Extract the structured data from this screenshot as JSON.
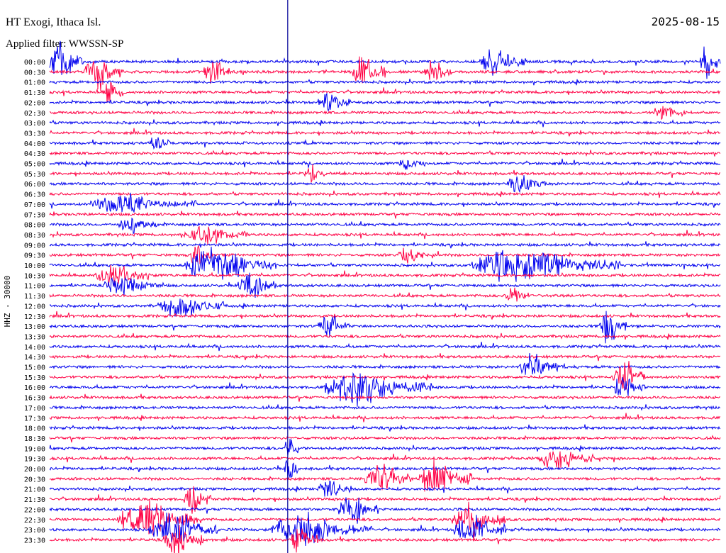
{
  "chart_data": {
    "type": "line",
    "title": "HT Exogi, Ithaca Isl.",
    "date": "2025-08-15",
    "filter": "Applied filter: WWSSN-SP",
    "ylabel": "HHZ - 30000",
    "colors": [
      "#0000ee",
      "#ff0044"
    ],
    "marker_color": "#000099",
    "row_labels": [
      "00:00",
      "00:30",
      "01:00",
      "01:30",
      "02:00",
      "02:30",
      "03:00",
      "03:30",
      "04:00",
      "04:30",
      "05:00",
      "05:30",
      "06:00",
      "06:30",
      "07:00",
      "07:30",
      "08:00",
      "08:30",
      "09:00",
      "09:30",
      "10:00",
      "10:30",
      "11:00",
      "11:30",
      "12:00",
      "12:30",
      "13:00",
      "13:30",
      "14:00",
      "14:30",
      "15:00",
      "15:30",
      "16:00",
      "16:30",
      "17:00",
      "17:30",
      "18:00",
      "18:30",
      "19:00",
      "19:30",
      "20:00",
      "20:30",
      "21:00",
      "21:30",
      "22:00",
      "22:30",
      "23:00",
      "23:30"
    ],
    "bursts": [
      {
        "row": 0,
        "x": 0.0,
        "w": 0.05,
        "amp": 2.2
      },
      {
        "row": 1,
        "x": 0.05,
        "w": 0.06,
        "amp": 1.8
      },
      {
        "row": 1,
        "x": 0.23,
        "w": 0.04,
        "amp": 1.6
      },
      {
        "row": 1,
        "x": 0.45,
        "w": 0.05,
        "amp": 1.8
      },
      {
        "row": 1,
        "x": 0.56,
        "w": 0.04,
        "amp": 1.2
      },
      {
        "row": 0,
        "x": 0.64,
        "w": 0.07,
        "amp": 1.4
      },
      {
        "row": 0,
        "x": 0.97,
        "w": 0.03,
        "amp": 2.2
      },
      {
        "row": 3,
        "x": 0.08,
        "w": 0.03,
        "amp": 1.2
      },
      {
        "row": 4,
        "x": 0.4,
        "w": 0.05,
        "amp": 0.9
      },
      {
        "row": 5,
        "x": 0.9,
        "w": 0.05,
        "amp": 0.9
      },
      {
        "row": 8,
        "x": 0.15,
        "w": 0.03,
        "amp": 0.9
      },
      {
        "row": 10,
        "x": 0.52,
        "w": 0.04,
        "amp": 0.8
      },
      {
        "row": 11,
        "x": 0.38,
        "w": 0.03,
        "amp": 0.8
      },
      {
        "row": 12,
        "x": 0.68,
        "w": 0.06,
        "amp": 1.0
      },
      {
        "row": 14,
        "x": 0.06,
        "w": 0.16,
        "amp": 1.0
      },
      {
        "row": 16,
        "x": 0.1,
        "w": 0.06,
        "amp": 0.8
      },
      {
        "row": 17,
        "x": 0.2,
        "w": 0.1,
        "amp": 0.8
      },
      {
        "row": 19,
        "x": 0.21,
        "w": 0.03,
        "amp": 1.2
      },
      {
        "row": 19,
        "x": 0.52,
        "w": 0.04,
        "amp": 1.0
      },
      {
        "row": 20,
        "x": 0.2,
        "w": 0.14,
        "amp": 1.9
      },
      {
        "row": 20,
        "x": 0.63,
        "w": 0.22,
        "amp": 1.8
      },
      {
        "row": 21,
        "x": 0.07,
        "w": 0.08,
        "amp": 1.2
      },
      {
        "row": 22,
        "x": 0.08,
        "w": 0.08,
        "amp": 1.2
      },
      {
        "row": 22,
        "x": 0.28,
        "w": 0.06,
        "amp": 1.2
      },
      {
        "row": 23,
        "x": 0.68,
        "w": 0.03,
        "amp": 1.1
      },
      {
        "row": 24,
        "x": 0.16,
        "w": 0.1,
        "amp": 1.3
      },
      {
        "row": 26,
        "x": 0.4,
        "w": 0.05,
        "amp": 1.1
      },
      {
        "row": 26,
        "x": 0.82,
        "w": 0.04,
        "amp": 2.0
      },
      {
        "row": 30,
        "x": 0.7,
        "w": 0.06,
        "amp": 1.3
      },
      {
        "row": 32,
        "x": 0.41,
        "w": 0.16,
        "amp": 1.8
      },
      {
        "row": 32,
        "x": 0.84,
        "w": 0.05,
        "amp": 1.2
      },
      {
        "row": 31,
        "x": 0.84,
        "w": 0.05,
        "amp": 1.6
      },
      {
        "row": 38,
        "x": 0.35,
        "w": 0.02,
        "amp": 1.6
      },
      {
        "row": 39,
        "x": 0.73,
        "w": 0.08,
        "amp": 1.3
      },
      {
        "row": 40,
        "x": 0.35,
        "w": 0.02,
        "amp": 1.8
      },
      {
        "row": 41,
        "x": 0.47,
        "w": 0.07,
        "amp": 1.6
      },
      {
        "row": 41,
        "x": 0.55,
        "w": 0.08,
        "amp": 1.8
      },
      {
        "row": 42,
        "x": 0.4,
        "w": 0.05,
        "amp": 1.1
      },
      {
        "row": 43,
        "x": 0.2,
        "w": 0.04,
        "amp": 1.6
      },
      {
        "row": 44,
        "x": 0.43,
        "w": 0.06,
        "amp": 1.6
      },
      {
        "row": 45,
        "x": 0.1,
        "w": 0.12,
        "amp": 1.8
      },
      {
        "row": 45,
        "x": 0.6,
        "w": 0.08,
        "amp": 1.8
      },
      {
        "row": 46,
        "x": 0.15,
        "w": 0.1,
        "amp": 1.8
      },
      {
        "row": 46,
        "x": 0.33,
        "w": 0.15,
        "amp": 1.8
      },
      {
        "row": 46,
        "x": 0.6,
        "w": 0.08,
        "amp": 1.6
      },
      {
        "row": 47,
        "x": 0.17,
        "w": 0.06,
        "amp": 1.6
      },
      {
        "row": 47,
        "x": 0.36,
        "w": 0.04,
        "amp": 1.6
      }
    ],
    "event_marker_x": 0.355
  }
}
